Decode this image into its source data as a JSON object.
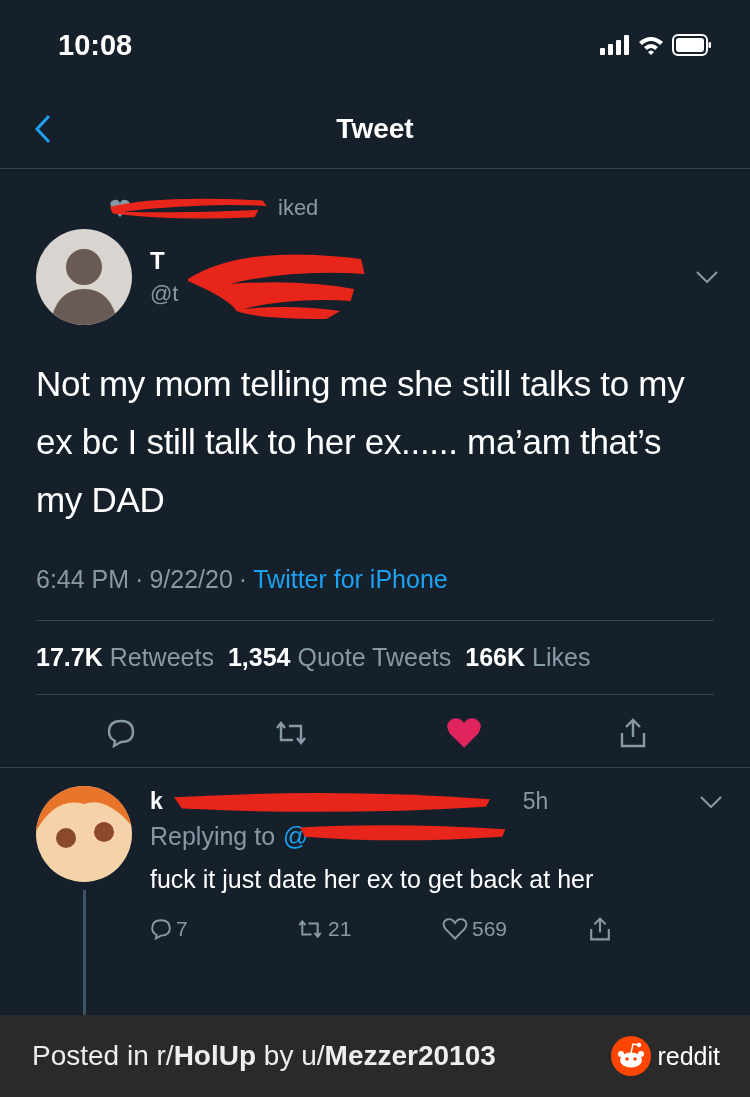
{
  "status_bar": {
    "time": "10:08"
  },
  "header": {
    "title": "Tweet"
  },
  "social_context": {
    "text": "iked"
  },
  "author": {
    "name_fragment": "T",
    "handle_fragment": "@t"
  },
  "tweet": {
    "text": "Not my mom telling me she still talks to my ex bc I still talk to her ex...... ma’am that’s my DAD",
    "time": "6:44 PM",
    "separator": "·",
    "date": "9/22/20",
    "source": "Twitter for iPhone"
  },
  "stats": [
    {
      "count": "17.7K",
      "label": "Retweets"
    },
    {
      "count": "1,354",
      "label": "Quote Tweets"
    },
    {
      "count": "166K",
      "label": "Likes"
    }
  ],
  "actions": {
    "liked": true
  },
  "reply": {
    "name_fragment": "k",
    "time": "5h",
    "replying_label": "Replying to",
    "replying_handle": "@",
    "text": "fuck it just date her ex to get back at her",
    "replies": "7",
    "retweets": "21",
    "likes": "569"
  },
  "footer": {
    "text": "Posted in r/**HolUp** by u/**Mezzer20103**",
    "brand": "reddit"
  }
}
